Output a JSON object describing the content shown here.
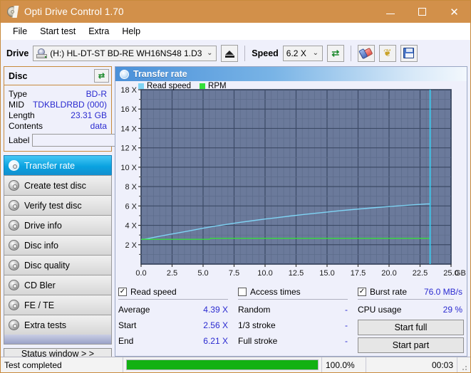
{
  "window": {
    "title": "Opti Drive Control 1.70",
    "icon": "cd-disc-icon",
    "minimize": "–",
    "maximize": "□",
    "close": "✕"
  },
  "menu": [
    {
      "label": "File"
    },
    {
      "label": "Start test"
    },
    {
      "label": "Extra"
    },
    {
      "label": "Help"
    }
  ],
  "toolbar": {
    "drive_label": "Drive",
    "drive_value": "(H:)  HL-DT-ST BD-RE  WH16NS48 1.D3",
    "eject_title": "eject-button",
    "speed_label": "Speed",
    "speed_value": "6.2 X",
    "refresh_icon": "⇄",
    "tools_icon": "❦",
    "chevron": "⌄"
  },
  "disc": {
    "header": "Disc",
    "refresh_icon": "⇄",
    "rows": [
      {
        "key": "Type",
        "value": "BD-R"
      },
      {
        "key": "MID",
        "value": "TDKBLDRBD (000)"
      },
      {
        "key": "Length",
        "value": "23.31 GB"
      },
      {
        "key": "Contents",
        "value": "data"
      }
    ],
    "label_key": "Label",
    "label_value": "",
    "label_placeholder": ""
  },
  "nav": {
    "items": [
      {
        "label": "Transfer rate",
        "active": true
      },
      {
        "label": "Create test disc",
        "active": false
      },
      {
        "label": "Verify test disc",
        "active": false
      },
      {
        "label": "Drive info",
        "active": false
      },
      {
        "label": "Disc info",
        "active": false
      },
      {
        "label": "Disc quality",
        "active": false
      },
      {
        "label": "CD Bler",
        "active": false
      },
      {
        "label": "FE / TE",
        "active": false
      },
      {
        "label": "Extra tests",
        "active": false
      }
    ],
    "status_window": "Status window > >"
  },
  "panel": {
    "title": "Transfer rate"
  },
  "chart_data": {
    "type": "line",
    "title": "Transfer rate",
    "xlabel": "GB",
    "ylabel": "X",
    "xlim": [
      0.0,
      25.0
    ],
    "ylim": [
      0.0,
      18.0
    ],
    "xticks": [
      "0.0",
      "2.5",
      "5.0",
      "7.5",
      "10.0",
      "12.5",
      "15.0",
      "17.5",
      "20.0",
      "22.5",
      "25.0"
    ],
    "xtick_values": [
      0.0,
      2.5,
      5.0,
      7.5,
      10.0,
      12.5,
      15.0,
      17.5,
      20.0,
      22.5,
      25.0
    ],
    "xunit": "GB",
    "yticks": [
      "2 X",
      "4 X",
      "6 X",
      "8 X",
      "10 X",
      "12 X",
      "14 X",
      "16 X",
      "18 X"
    ],
    "ytick_values": [
      2,
      4,
      6,
      8,
      10,
      12,
      14,
      16,
      18
    ],
    "grid": true,
    "legend": [
      {
        "name": "Read speed",
        "color": "#7fd4f5"
      },
      {
        "name": "RPM",
        "color": "#35e03b"
      }
    ],
    "plot_bg": "#6b7a9b",
    "grid_color": "#3c4a66",
    "minor_grid_color": "#5d6c8b",
    "end_marker": {
      "x": 23.31,
      "color": "#35d2f5"
    },
    "series": [
      {
        "name": "Read speed",
        "color": "#7fd4f5",
        "x": [
          0.0,
          0.3,
          0.8,
          1.5,
          2.3,
          3.1,
          4.0,
          5.0,
          6.0,
          7.0,
          8.0,
          9.0,
          10.0,
          11.0,
          12.0,
          13.0,
          14.0,
          15.0,
          16.0,
          17.0,
          18.0,
          19.0,
          20.0,
          21.0,
          22.0,
          23.0,
          23.31
        ],
        "y": [
          2.56,
          2.58,
          2.7,
          2.88,
          3.06,
          3.25,
          3.46,
          3.7,
          3.92,
          4.12,
          4.31,
          4.48,
          4.65,
          4.8,
          4.96,
          5.1,
          5.24,
          5.37,
          5.5,
          5.62,
          5.73,
          5.84,
          5.94,
          6.03,
          6.12,
          6.2,
          6.21
        ]
      },
      {
        "name": "RPM",
        "color": "#35e03b",
        "x": [
          0.0,
          5.5,
          5.6,
          23.31
        ],
        "y": [
          2.56,
          2.56,
          2.66,
          2.66
        ]
      }
    ]
  },
  "stats": {
    "read_speed": {
      "checkbox_label": "Read speed",
      "checked": true,
      "rows": [
        {
          "key": "Average",
          "value": "4.39 X"
        },
        {
          "key": "Start",
          "value": "2.56 X"
        },
        {
          "key": "End",
          "value": "6.21 X"
        }
      ]
    },
    "access_times": {
      "checkbox_label": "Access times",
      "checked": false,
      "rows": [
        {
          "key": "Random",
          "value": "-"
        },
        {
          "key": "1/3 stroke",
          "value": "-"
        },
        {
          "key": "Full stroke",
          "value": "-"
        }
      ]
    },
    "burst": {
      "checkbox_label": "Burst rate",
      "checked": true,
      "burst_value": "76.0 MB/s",
      "cpu_key": "CPU usage",
      "cpu_value": "29 %",
      "start_full": "Start full",
      "start_part": "Start part"
    },
    "check_glyph": "✓"
  },
  "statusbar": {
    "message": "Test completed",
    "progress_percent": 100.0,
    "progress_text": "100.0%",
    "elapsed": "00:03",
    "progress_color": "#12b112"
  }
}
